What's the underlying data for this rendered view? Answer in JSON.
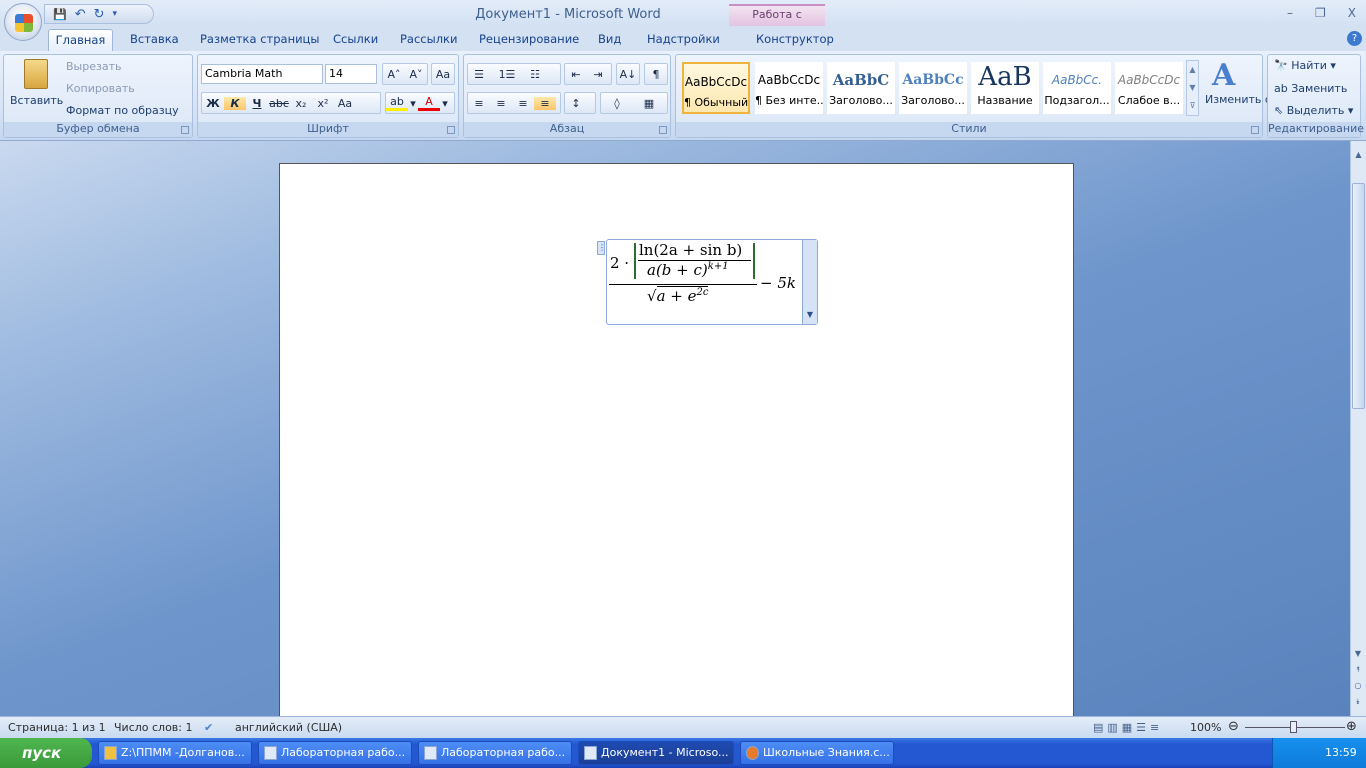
{
  "window": {
    "title": "Документ1 - Microsoft Word",
    "context_tab_group": "Работа с формулами",
    "minimize": "–",
    "restore": "❐",
    "close": "X"
  },
  "qat": {
    "save": "💾",
    "undo": "↶",
    "redo": "↻",
    "customize": "▾"
  },
  "tabs": [
    "Главная",
    "Вставка",
    "Разметка страницы",
    "Ссылки",
    "Рассылки",
    "Рецензирование",
    "Вид",
    "Надстройки",
    "Конструктор"
  ],
  "help": "?",
  "clipboard": {
    "paste": "Вставить",
    "cut": "Вырезать",
    "copy": "Копировать",
    "format_painter": "Формат по образцу",
    "label": "Буфер обмена"
  },
  "font": {
    "name": "Cambria Math",
    "size": "14",
    "grow": "A˄",
    "shrink": "A˅",
    "clear": "Aa",
    "bold": "Ж",
    "italic": "К",
    "underline": "Ч",
    "strike": "abc",
    "sub": "x₂",
    "sup": "x²",
    "case": "Aa",
    "highlight": "ab",
    "color": "A",
    "label": "Шрифт"
  },
  "paragraph": {
    "bullets": "☰",
    "numbering": "1☰",
    "multilevel": "☷",
    "dec_indent": "⇤",
    "inc_indent": "⇥",
    "sort": "A↓",
    "pilcrow": "¶",
    "left": "≡",
    "center": "≡",
    "right": "≡",
    "justify": "≡",
    "spacing": "↕",
    "shading": "◊",
    "borders": "▦",
    "label": "Абзац"
  },
  "styles": {
    "items": [
      {
        "preview": "AaBbCcDc",
        "name": "¶ Обычный"
      },
      {
        "preview": "AaBbCcDc",
        "name": "¶ Без инте..."
      },
      {
        "preview": "AaBbC",
        "name": "Заголово..."
      },
      {
        "preview": "AaBbCc",
        "name": "Заголово..."
      },
      {
        "preview": "AaB",
        "name": "Название"
      },
      {
        "preview": "AaBbCc.",
        "name": "Подзагол..."
      },
      {
        "preview": "AaBbCcDc",
        "name": "Слабое в..."
      }
    ],
    "change": "Изменить стили",
    "label": "Стили"
  },
  "editing": {
    "find": "Найти",
    "replace": "Заменить",
    "select": "Выделить",
    "label": "Редактирование"
  },
  "equation": {
    "coef": "2 ·",
    "num_top": "ln(2a + sin b)",
    "num_bottom_base": "a(b + c)",
    "num_bottom_exp": "k+1",
    "den_base": "a + e",
    "den_exp": "2c",
    "tail": "− 5k"
  },
  "status": {
    "page": "Страница: 1 из 1",
    "words": "Число слов: 1",
    "language": "английский (США)",
    "zoom": "100%",
    "zoom_level": 100
  },
  "taskbar": {
    "start": "пуск",
    "tasks": [
      "Z:\\ППММ -Долганов...",
      "Лабораторная рабо...",
      "Лабораторная рабо...",
      "Документ1 - Microso...",
      "Школьные Знания.c..."
    ],
    "clock": "13:59"
  }
}
